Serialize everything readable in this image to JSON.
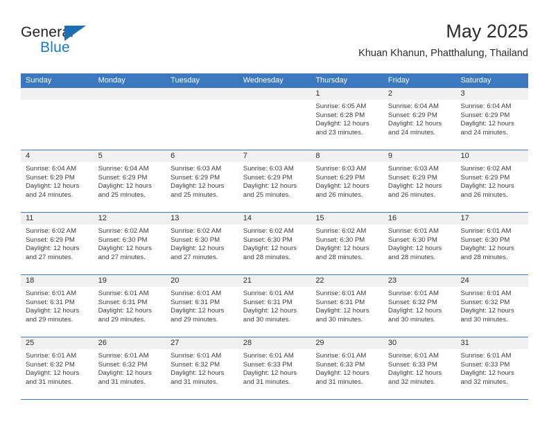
{
  "logo": {
    "word_top": "General",
    "word_bottom": "Blue",
    "triangle_color": "#1b6fb5",
    "blue_color": "#1a7bc4"
  },
  "header": {
    "title": "May 2025",
    "subtitle": "Khuan Khanun, Phatthalung, Thailand",
    "accent_color": "#3b78bf",
    "band_color": "#f0f0f0"
  },
  "weekdays": [
    "Sunday",
    "Monday",
    "Tuesday",
    "Wednesday",
    "Thursday",
    "Friday",
    "Saturday"
  ],
  "weeks": [
    [
      {
        "date": "",
        "empty": true
      },
      {
        "date": "",
        "empty": true
      },
      {
        "date": "",
        "empty": true
      },
      {
        "date": "",
        "empty": true
      },
      {
        "date": "1",
        "sunrise": "Sunrise: 6:05 AM",
        "sunset": "Sunset: 6:28 PM",
        "daylight_1": "Daylight: 12 hours",
        "daylight_2": "and 23 minutes."
      },
      {
        "date": "2",
        "sunrise": "Sunrise: 6:04 AM",
        "sunset": "Sunset: 6:29 PM",
        "daylight_1": "Daylight: 12 hours",
        "daylight_2": "and 24 minutes."
      },
      {
        "date": "3",
        "sunrise": "Sunrise: 6:04 AM",
        "sunset": "Sunset: 6:29 PM",
        "daylight_1": "Daylight: 12 hours",
        "daylight_2": "and 24 minutes."
      }
    ],
    [
      {
        "date": "4",
        "sunrise": "Sunrise: 6:04 AM",
        "sunset": "Sunset: 6:29 PM",
        "daylight_1": "Daylight: 12 hours",
        "daylight_2": "and 24 minutes."
      },
      {
        "date": "5",
        "sunrise": "Sunrise: 6:04 AM",
        "sunset": "Sunset: 6:29 PM",
        "daylight_1": "Daylight: 12 hours",
        "daylight_2": "and 25 minutes."
      },
      {
        "date": "6",
        "sunrise": "Sunrise: 6:03 AM",
        "sunset": "Sunset: 6:29 PM",
        "daylight_1": "Daylight: 12 hours",
        "daylight_2": "and 25 minutes."
      },
      {
        "date": "7",
        "sunrise": "Sunrise: 6:03 AM",
        "sunset": "Sunset: 6:29 PM",
        "daylight_1": "Daylight: 12 hours",
        "daylight_2": "and 25 minutes."
      },
      {
        "date": "8",
        "sunrise": "Sunrise: 6:03 AM",
        "sunset": "Sunset: 6:29 PM",
        "daylight_1": "Daylight: 12 hours",
        "daylight_2": "and 26 minutes."
      },
      {
        "date": "9",
        "sunrise": "Sunrise: 6:03 AM",
        "sunset": "Sunset: 6:29 PM",
        "daylight_1": "Daylight: 12 hours",
        "daylight_2": "and 26 minutes."
      },
      {
        "date": "10",
        "sunrise": "Sunrise: 6:02 AM",
        "sunset": "Sunset: 6:29 PM",
        "daylight_1": "Daylight: 12 hours",
        "daylight_2": "and 26 minutes."
      }
    ],
    [
      {
        "date": "11",
        "sunrise": "Sunrise: 6:02 AM",
        "sunset": "Sunset: 6:29 PM",
        "daylight_1": "Daylight: 12 hours",
        "daylight_2": "and 27 minutes."
      },
      {
        "date": "12",
        "sunrise": "Sunrise: 6:02 AM",
        "sunset": "Sunset: 6:30 PM",
        "daylight_1": "Daylight: 12 hours",
        "daylight_2": "and 27 minutes."
      },
      {
        "date": "13",
        "sunrise": "Sunrise: 6:02 AM",
        "sunset": "Sunset: 6:30 PM",
        "daylight_1": "Daylight: 12 hours",
        "daylight_2": "and 27 minutes."
      },
      {
        "date": "14",
        "sunrise": "Sunrise: 6:02 AM",
        "sunset": "Sunset: 6:30 PM",
        "daylight_1": "Daylight: 12 hours",
        "daylight_2": "and 28 minutes."
      },
      {
        "date": "15",
        "sunrise": "Sunrise: 6:02 AM",
        "sunset": "Sunset: 6:30 PM",
        "daylight_1": "Daylight: 12 hours",
        "daylight_2": "and 28 minutes."
      },
      {
        "date": "16",
        "sunrise": "Sunrise: 6:01 AM",
        "sunset": "Sunset: 6:30 PM",
        "daylight_1": "Daylight: 12 hours",
        "daylight_2": "and 28 minutes."
      },
      {
        "date": "17",
        "sunrise": "Sunrise: 6:01 AM",
        "sunset": "Sunset: 6:30 PM",
        "daylight_1": "Daylight: 12 hours",
        "daylight_2": "and 28 minutes."
      }
    ],
    [
      {
        "date": "18",
        "sunrise": "Sunrise: 6:01 AM",
        "sunset": "Sunset: 6:31 PM",
        "daylight_1": "Daylight: 12 hours",
        "daylight_2": "and 29 minutes."
      },
      {
        "date": "19",
        "sunrise": "Sunrise: 6:01 AM",
        "sunset": "Sunset: 6:31 PM",
        "daylight_1": "Daylight: 12 hours",
        "daylight_2": "and 29 minutes."
      },
      {
        "date": "20",
        "sunrise": "Sunrise: 6:01 AM",
        "sunset": "Sunset: 6:31 PM",
        "daylight_1": "Daylight: 12 hours",
        "daylight_2": "and 29 minutes."
      },
      {
        "date": "21",
        "sunrise": "Sunrise: 6:01 AM",
        "sunset": "Sunset: 6:31 PM",
        "daylight_1": "Daylight: 12 hours",
        "daylight_2": "and 30 minutes."
      },
      {
        "date": "22",
        "sunrise": "Sunrise: 6:01 AM",
        "sunset": "Sunset: 6:31 PM",
        "daylight_1": "Daylight: 12 hours",
        "daylight_2": "and 30 minutes."
      },
      {
        "date": "23",
        "sunrise": "Sunrise: 6:01 AM",
        "sunset": "Sunset: 6:32 PM",
        "daylight_1": "Daylight: 12 hours",
        "daylight_2": "and 30 minutes."
      },
      {
        "date": "24",
        "sunrise": "Sunrise: 6:01 AM",
        "sunset": "Sunset: 6:32 PM",
        "daylight_1": "Daylight: 12 hours",
        "daylight_2": "and 30 minutes."
      }
    ],
    [
      {
        "date": "25",
        "sunrise": "Sunrise: 6:01 AM",
        "sunset": "Sunset: 6:32 PM",
        "daylight_1": "Daylight: 12 hours",
        "daylight_2": "and 31 minutes."
      },
      {
        "date": "26",
        "sunrise": "Sunrise: 6:01 AM",
        "sunset": "Sunset: 6:32 PM",
        "daylight_1": "Daylight: 12 hours",
        "daylight_2": "and 31 minutes."
      },
      {
        "date": "27",
        "sunrise": "Sunrise: 6:01 AM",
        "sunset": "Sunset: 6:32 PM",
        "daylight_1": "Daylight: 12 hours",
        "daylight_2": "and 31 minutes."
      },
      {
        "date": "28",
        "sunrise": "Sunrise: 6:01 AM",
        "sunset": "Sunset: 6:33 PM",
        "daylight_1": "Daylight: 12 hours",
        "daylight_2": "and 31 minutes."
      },
      {
        "date": "29",
        "sunrise": "Sunrise: 6:01 AM",
        "sunset": "Sunset: 6:33 PM",
        "daylight_1": "Daylight: 12 hours",
        "daylight_2": "and 31 minutes."
      },
      {
        "date": "30",
        "sunrise": "Sunrise: 6:01 AM",
        "sunset": "Sunset: 6:33 PM",
        "daylight_1": "Daylight: 12 hours",
        "daylight_2": "and 32 minutes."
      },
      {
        "date": "31",
        "sunrise": "Sunrise: 6:01 AM",
        "sunset": "Sunset: 6:33 PM",
        "daylight_1": "Daylight: 12 hours",
        "daylight_2": "and 32 minutes."
      }
    ]
  ]
}
